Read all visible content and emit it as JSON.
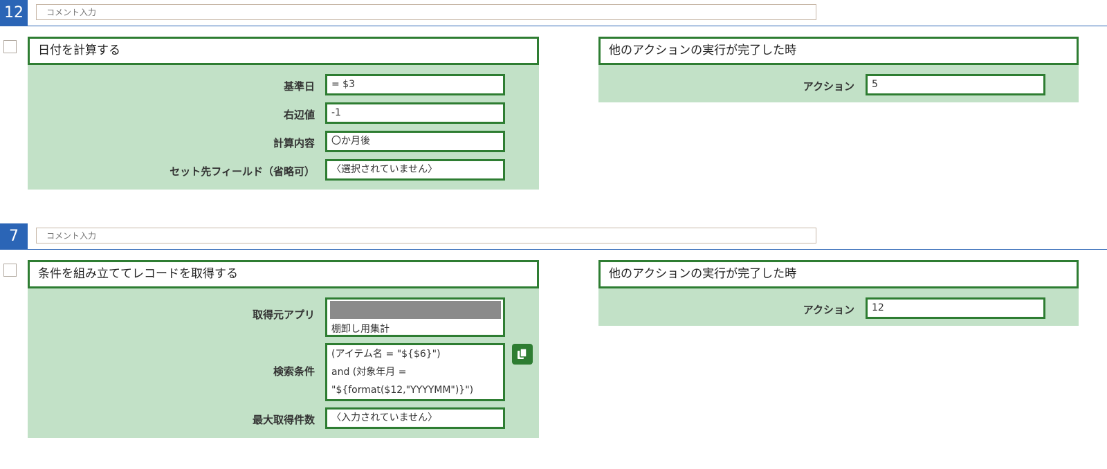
{
  "steps": [
    {
      "number": "12",
      "comment_placeholder": "コメント入力",
      "action": {
        "title": "日付を計算する",
        "fields": [
          {
            "label": "基準日",
            "value": "= $3"
          },
          {
            "label": "右辺値",
            "value": "-1"
          },
          {
            "label": "計算内容",
            "value": "〇か月後"
          },
          {
            "label": "セット先フィールド（省略可）",
            "value": "〈選択されていません〉"
          }
        ]
      },
      "trigger": {
        "title": "他のアクションの実行が完了した時",
        "label": "アクション",
        "value": "5"
      }
    },
    {
      "number": "7",
      "comment_placeholder": "コメント入力",
      "action": {
        "title": "条件を組み立ててレコードを取得する",
        "fields": [
          {
            "label": "取得元アプリ",
            "value": "棚卸し用集計"
          },
          {
            "label": "検索条件",
            "lines": [
              "(アイテム名 = \"${$6}\")",
              "and (対象年月 =",
              "\"${format($12,\"YYYYMM\")}\")"
            ]
          },
          {
            "label": "最大取得件数",
            "value": "〈入力されていません〉"
          }
        ]
      },
      "trigger": {
        "title": "他のアクションの実行が完了した時",
        "label": "アクション",
        "value": "12"
      }
    }
  ],
  "colors": {
    "step_blue": "#2b65b6",
    "panel_green": "#c2e1c7",
    "border_green": "#2e7d32"
  },
  "icons": {
    "copy": "copy-icon"
  }
}
